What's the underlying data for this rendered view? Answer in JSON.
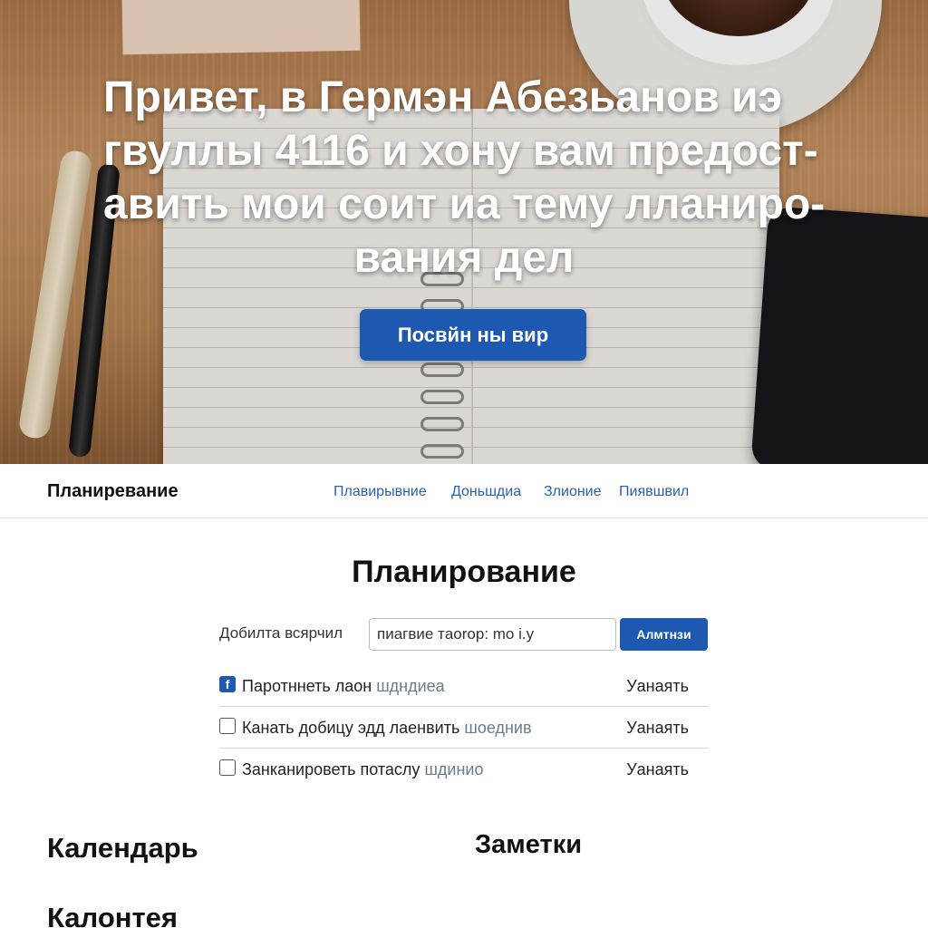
{
  "hero": {
    "title_lines": [
      "Привет, в Гермэн Абезьанов иэ",
      "гвуллы 4116 и хону вам предост-",
      "авить мои соит иа тему лланиро-",
      "вания дел"
    ],
    "button_label": "Посвйн ны вир"
  },
  "nav": {
    "brand": "Планиревание",
    "links": [
      "Плавирывние",
      "Доньшдиа",
      "Злионие",
      "Пиявшвил"
    ]
  },
  "main": {
    "title": "Планирование",
    "add_label": "Добилта всярчил",
    "input_value": "пиагвие тaorop: mo i.y",
    "add_button": "Алмтнзи",
    "tasks": [
      {
        "text": "Паротннеть лаон",
        "muted": "шдндиеа",
        "action": "Уанаять",
        "checked": true
      },
      {
        "text": "Канать добицу эдд лаенвить",
        "muted": "шоеднив",
        "action": "Уанаять",
        "checked": false
      },
      {
        "text": "Занканироветь потаслу",
        "muted": "шдинио",
        "action": "Уанаять",
        "checked": false
      }
    ],
    "calendar_heading": "Календарь",
    "notes_heading": "Заметки",
    "calendar_sub": "Калонтея"
  },
  "icons": {
    "checked_box": "checkbox-checked-icon",
    "unchecked_box": "checkbox-icon"
  },
  "colors": {
    "accent": "#1d59b0",
    "nav_link": "#2b5fb3"
  }
}
